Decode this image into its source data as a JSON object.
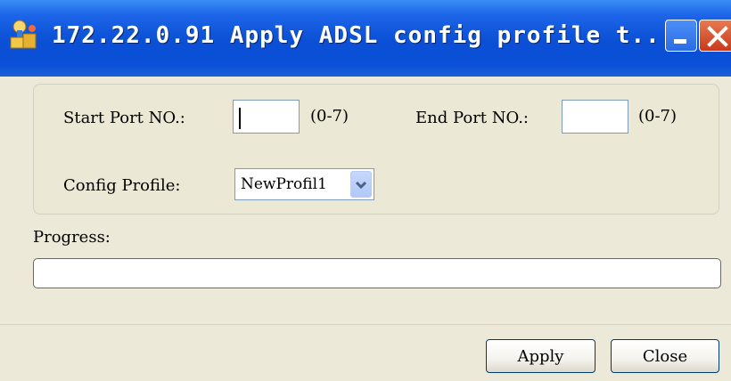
{
  "window": {
    "title": "172.22.0.91 Apply ADSL config profile t...",
    "minimize_glyph": "_",
    "close_glyph": "X"
  },
  "form": {
    "start_port_label": "Start Port NO.:",
    "start_port_value": "",
    "start_port_range": "(0-7)",
    "end_port_label": "End Port NO.:",
    "end_port_value": "",
    "end_port_range": "(0-7)",
    "config_profile_label": "Config Profile:",
    "config_profile_selected": "NewProfil1"
  },
  "progress": {
    "label": "Progress:",
    "value": 0
  },
  "buttons": {
    "apply": "Apply",
    "close": "Close"
  },
  "colors": {
    "titlebar": "#0a50d8",
    "window_bg": "#ece9d8",
    "close_button": "#c8391b",
    "input_border": "#7f9db9"
  },
  "icons": {
    "app": "app-icon",
    "minimize": "minimize-icon",
    "close": "close-icon",
    "dropdown": "chevron-down-icon"
  }
}
